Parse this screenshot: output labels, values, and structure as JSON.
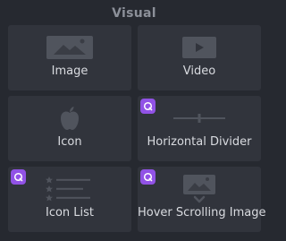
{
  "section": {
    "title": "Visual"
  },
  "widgets": [
    {
      "label": "Image",
      "icon": "image-icon",
      "pro": false
    },
    {
      "label": "Video",
      "icon": "video-play-icon",
      "pro": false
    },
    {
      "label": "Icon",
      "icon": "apple-icon",
      "pro": false
    },
    {
      "label": "Horizontal Divider",
      "icon": "divider-icon",
      "pro": true
    },
    {
      "label": "Icon List",
      "icon": "star-list-icon",
      "pro": true
    },
    {
      "label": "Hover Scrolling Image",
      "icon": "scrolling-image-icon",
      "pro": true
    }
  ],
  "colors": {
    "background": "#262930",
    "tile": "#31343c",
    "label": "#d9dbe0",
    "title": "#8c9099",
    "icon": "#50545d",
    "pro_badge": "#9152e6"
  }
}
